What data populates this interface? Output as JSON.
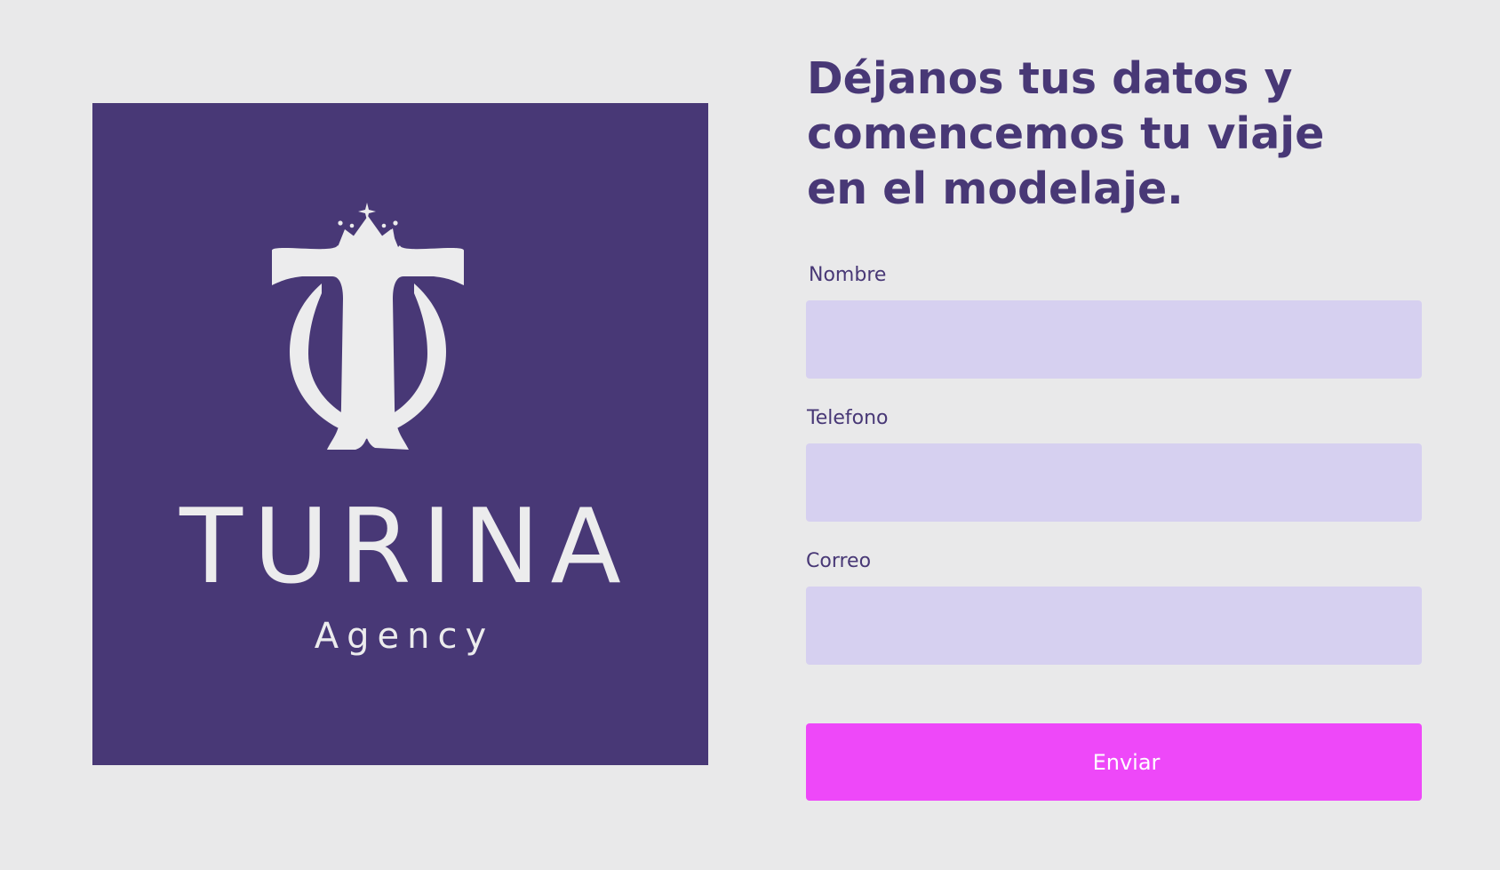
{
  "logo": {
    "brand": "TURINA",
    "subtitle": "Agency",
    "icon": "crown-t-monogram-icon"
  },
  "form": {
    "heading": [
      "Déjanos tus datos y",
      "comencemos tu viaje",
      "en el modelaje."
    ],
    "fields": [
      {
        "label": "Nombre",
        "value": "",
        "placeholder": ""
      },
      {
        "label": "Telefono",
        "value": "",
        "placeholder": ""
      },
      {
        "label": "Correo",
        "value": "",
        "placeholder": ""
      }
    ],
    "submit_label": "Enviar"
  },
  "colors": {
    "background": "#e9e9ea",
    "brand_purple": "#483876",
    "input_fill": "#d6d0f0",
    "accent_magenta": "#ee48f9",
    "logo_fg": "#ececed"
  }
}
